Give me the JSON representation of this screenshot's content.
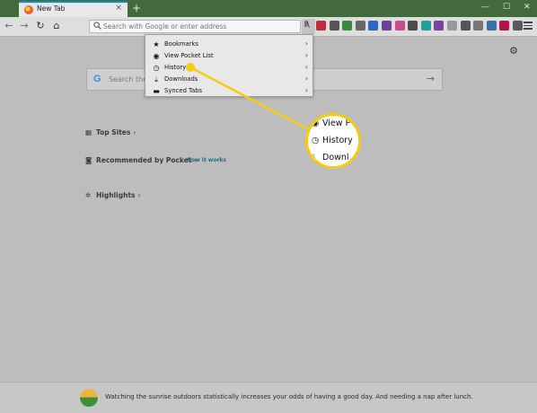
{
  "tab": {
    "title": "New Tab",
    "close": "×",
    "new_tab": "+"
  },
  "window_controls": {
    "minimize": "—",
    "maximize": "☐",
    "close": "✕"
  },
  "nav": {
    "back": "←",
    "forward": "→",
    "reload": "↻",
    "home": "⌂"
  },
  "urlbar": {
    "placeholder": "Search with Google or enter address"
  },
  "toolbar_icons": [
    {
      "name": "pocket-icon",
      "color": "#c22b3f"
    },
    {
      "name": "extension-1-icon",
      "color": "#555555"
    },
    {
      "name": "ad-block-icon",
      "color": "#2f8f3a"
    },
    {
      "name": "info-icon",
      "color": "#666666"
    },
    {
      "name": "extension-2-icon",
      "color": "#2b66c4"
    },
    {
      "name": "extension-3-icon",
      "color": "#6e3fa3"
    },
    {
      "name": "extension-4-icon",
      "color": "#c94b8c"
    },
    {
      "name": "extension-5-icon",
      "color": "#4c4c4c"
    },
    {
      "name": "extension-6-icon",
      "color": "#1aa3a3"
    },
    {
      "name": "onenote-icon",
      "color": "#7b3fa6"
    },
    {
      "name": "extension-7-icon",
      "color": "#999999"
    },
    {
      "name": "extension-8-icon",
      "color": "#555555"
    },
    {
      "name": "extension-9-icon",
      "color": "#777777"
    },
    {
      "name": "extension-10-icon",
      "color": "#3a6ea5"
    },
    {
      "name": "extension-11-icon",
      "color": "#b3124a"
    },
    {
      "name": "extension-12-icon",
      "color": "#5a5a5a"
    }
  ],
  "library_menu": {
    "items": [
      {
        "label": "Bookmarks",
        "icon": "star-icon",
        "glyph": "★"
      },
      {
        "label": "View Pocket List",
        "icon": "pocket-list-icon",
        "glyph": "◉"
      },
      {
        "label": "History",
        "icon": "clock-icon",
        "glyph": "◷"
      },
      {
        "label": "Downloads",
        "icon": "download-icon",
        "glyph": "⤓"
      },
      {
        "label": "Synced Tabs",
        "icon": "laptop-icon",
        "glyph": "▬"
      }
    ],
    "arrow": "›"
  },
  "magnifier": {
    "rows": [
      {
        "glyph": "◉",
        "text": "View P"
      },
      {
        "glyph": "◷",
        "text": "History"
      },
      {
        "glyph": "⤓",
        "text": "Downl"
      }
    ]
  },
  "page": {
    "search_placeholder": "Search the W",
    "search_go": "→",
    "google_logo": "G",
    "settings_glyph": "⚙",
    "top_sites": "Top Sites",
    "pocket_heading": "Recommended by Pocket",
    "pocket_link": "How it works",
    "highlights": "Highlights",
    "chevron": "›"
  },
  "snippet": {
    "text": "Watching the sunrise outdoors statistically increases your odds of having a good day. And needing a nap after lunch."
  },
  "colors": {
    "tab_strip": "#43693f",
    "accent": "#f5cc14",
    "page_bg": "#bdbdbd"
  }
}
